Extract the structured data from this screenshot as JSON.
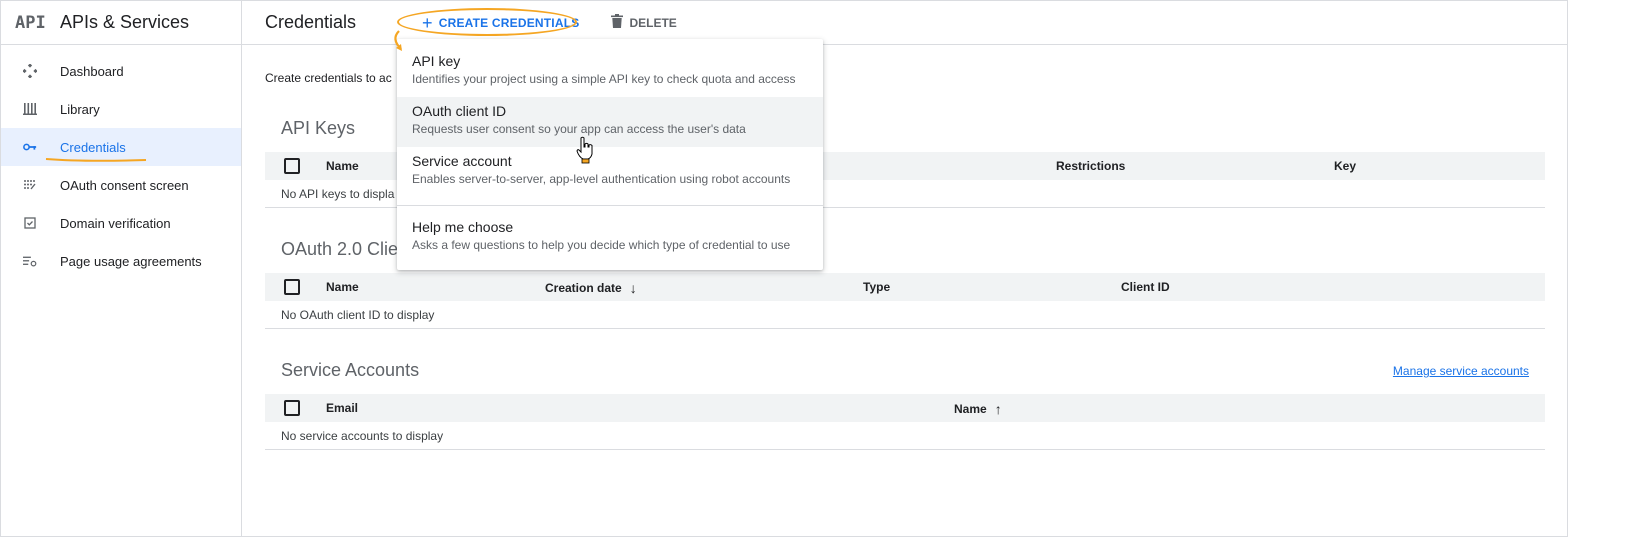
{
  "sidebar": {
    "logo": "API",
    "title": "APIs & Services",
    "items": [
      {
        "label": "Dashboard",
        "icon": "dashboard-icon"
      },
      {
        "label": "Library",
        "icon": "library-icon"
      },
      {
        "label": "Credentials",
        "icon": "key-icon",
        "active": true
      },
      {
        "label": "OAuth consent screen",
        "icon": "consent-icon"
      },
      {
        "label": "Domain verification",
        "icon": "domain-check-icon"
      },
      {
        "label": "Page usage agreements",
        "icon": "settings-list-icon"
      }
    ]
  },
  "header": {
    "title": "Credentials",
    "create_label": "CREATE CREDENTIALS",
    "delete_label": "DELETE"
  },
  "main": {
    "intro": "Create credentials to ac"
  },
  "api_keys": {
    "title": "API Keys",
    "columns": [
      "Name",
      "Restrictions",
      "Key"
    ],
    "empty": "No API keys to displa"
  },
  "oauth": {
    "title": "OAuth 2.0 Clie",
    "columns": [
      "Name",
      "Creation date",
      "Type",
      "Client ID"
    ],
    "empty": "No OAuth client ID to display"
  },
  "service_accounts": {
    "title": "Service Accounts",
    "manage_link": "Manage service accounts",
    "columns": [
      "Email",
      "Name"
    ],
    "empty": "No service accounts to display"
  },
  "dropdown": {
    "items": [
      {
        "title": "API key",
        "desc": "Identifies your project using a simple API key to check quota and access"
      },
      {
        "title": "OAuth client ID",
        "desc": "Requests user consent so your app can access the user's data"
      },
      {
        "title": "Service account",
        "desc": "Enables server-to-server, app-level authentication using robot accounts"
      },
      {
        "title": "Help me choose",
        "desc": "Asks a few questions to help you decide which type of credential to use"
      }
    ]
  },
  "colors": {
    "accent": "#1a73e8",
    "annotation": "#f5a623",
    "active_bg": "#e8f0fe"
  }
}
